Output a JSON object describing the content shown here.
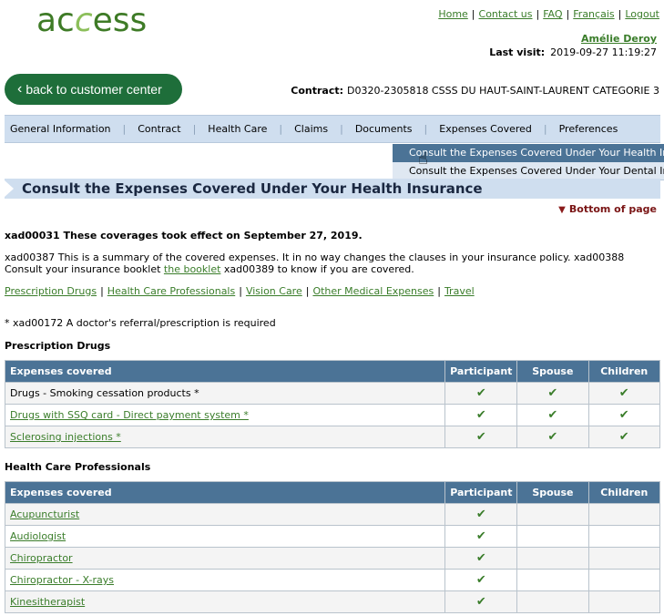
{
  "header": {
    "logo_text_a": "ac",
    "logo_text_b": "c",
    "logo_text_c": "ess",
    "links": [
      "Home",
      "Contact us",
      "FAQ",
      "Français",
      "Logout"
    ],
    "user_name": "Amélie Deroy",
    "last_visit_label": "Last visit:",
    "last_visit_value": "2019-09-27 11:19:27",
    "back_button": "back to customer center",
    "contract_label": "Contract:",
    "contract_value": "D0320-2305818 CSSS DU HAUT-SAINT-LAURENT CATEGORIE 3"
  },
  "nav": {
    "items": [
      "General Information",
      "Contract",
      "Health Care",
      "Claims",
      "Documents",
      "Expenses Covered",
      "Preferences"
    ],
    "submenu": [
      "Consult the Expenses Covered Under Your Health Insurance",
      "Consult the Expenses Covered Under Your Dental Insurance"
    ]
  },
  "page": {
    "title": "Consult the Expenses Covered Under Your Health Insurance",
    "bottom_link": "Bottom of page",
    "effective": "xad00031 These coverages took effect on September 27, 2019.",
    "summary_a": "xad00387 This is a summary of the covered expenses. It in no way changes the clauses in your insurance policy. xad00388 Consult your insurance booklet ",
    "summary_link": "the booklet",
    "summary_b": " xad00389 to know if you are covered.",
    "section_links": [
      "Prescription Drugs",
      "Health Care Professionals",
      "Vision Care",
      "Other Medical Expenses",
      "Travel"
    ],
    "note": "* xad00172 A doctor's referral/prescription is required"
  },
  "columns": [
    "Expenses covered",
    "Participant",
    "Spouse",
    "Children"
  ],
  "check_icon": "check-icon",
  "sections": [
    {
      "heading": "Prescription Drugs",
      "rows": [
        {
          "label": "Drugs - Smoking cessation products *",
          "link": false,
          "participant": true,
          "spouse": true,
          "children": true
        },
        {
          "label": "Drugs with SSQ card - Direct payment system *",
          "link": true,
          "participant": true,
          "spouse": true,
          "children": true
        },
        {
          "label": "Sclerosing injections *",
          "link": true,
          "participant": true,
          "spouse": true,
          "children": true
        }
      ]
    },
    {
      "heading": "Health Care Professionals",
      "rows": [
        {
          "label": "Acupuncturist",
          "link": true,
          "participant": true,
          "spouse": false,
          "children": false
        },
        {
          "label": "Audiologist",
          "link": true,
          "participant": true,
          "spouse": false,
          "children": false
        },
        {
          "label": "Chiropractor",
          "link": true,
          "participant": true,
          "spouse": false,
          "children": false
        },
        {
          "label": "Chiropractor - X-rays",
          "link": true,
          "participant": true,
          "spouse": false,
          "children": false
        },
        {
          "label": "Kinesitherapist",
          "link": true,
          "participant": true,
          "spouse": false,
          "children": false
        }
      ]
    }
  ]
}
